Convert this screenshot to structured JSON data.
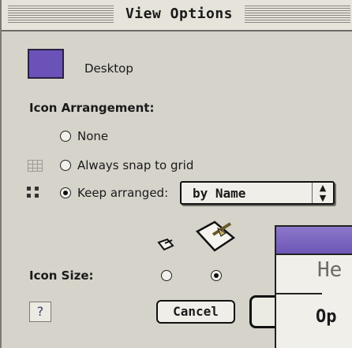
{
  "window": {
    "title": "View Options"
  },
  "desktop": {
    "label": "Desktop",
    "swatch_color": "#6a52b8"
  },
  "icon_arrangement": {
    "heading": "Icon Arrangement:",
    "options": [
      {
        "label": "None",
        "selected": false
      },
      {
        "label": "Always snap to grid",
        "selected": false
      },
      {
        "label": "Keep arranged:",
        "selected": true
      }
    ],
    "sort_popup": {
      "value": "by Name",
      "arrow": "⇕"
    }
  },
  "icon_size": {
    "heading": "Icon Size:",
    "options": [
      {
        "size": "small",
        "selected": false
      },
      {
        "size": "large",
        "selected": true
      }
    ]
  },
  "buttons": {
    "help_label": "?",
    "cancel_label": "Cancel"
  },
  "background_window": {
    "title_fragment": "He",
    "item_fragment": "Op"
  }
}
